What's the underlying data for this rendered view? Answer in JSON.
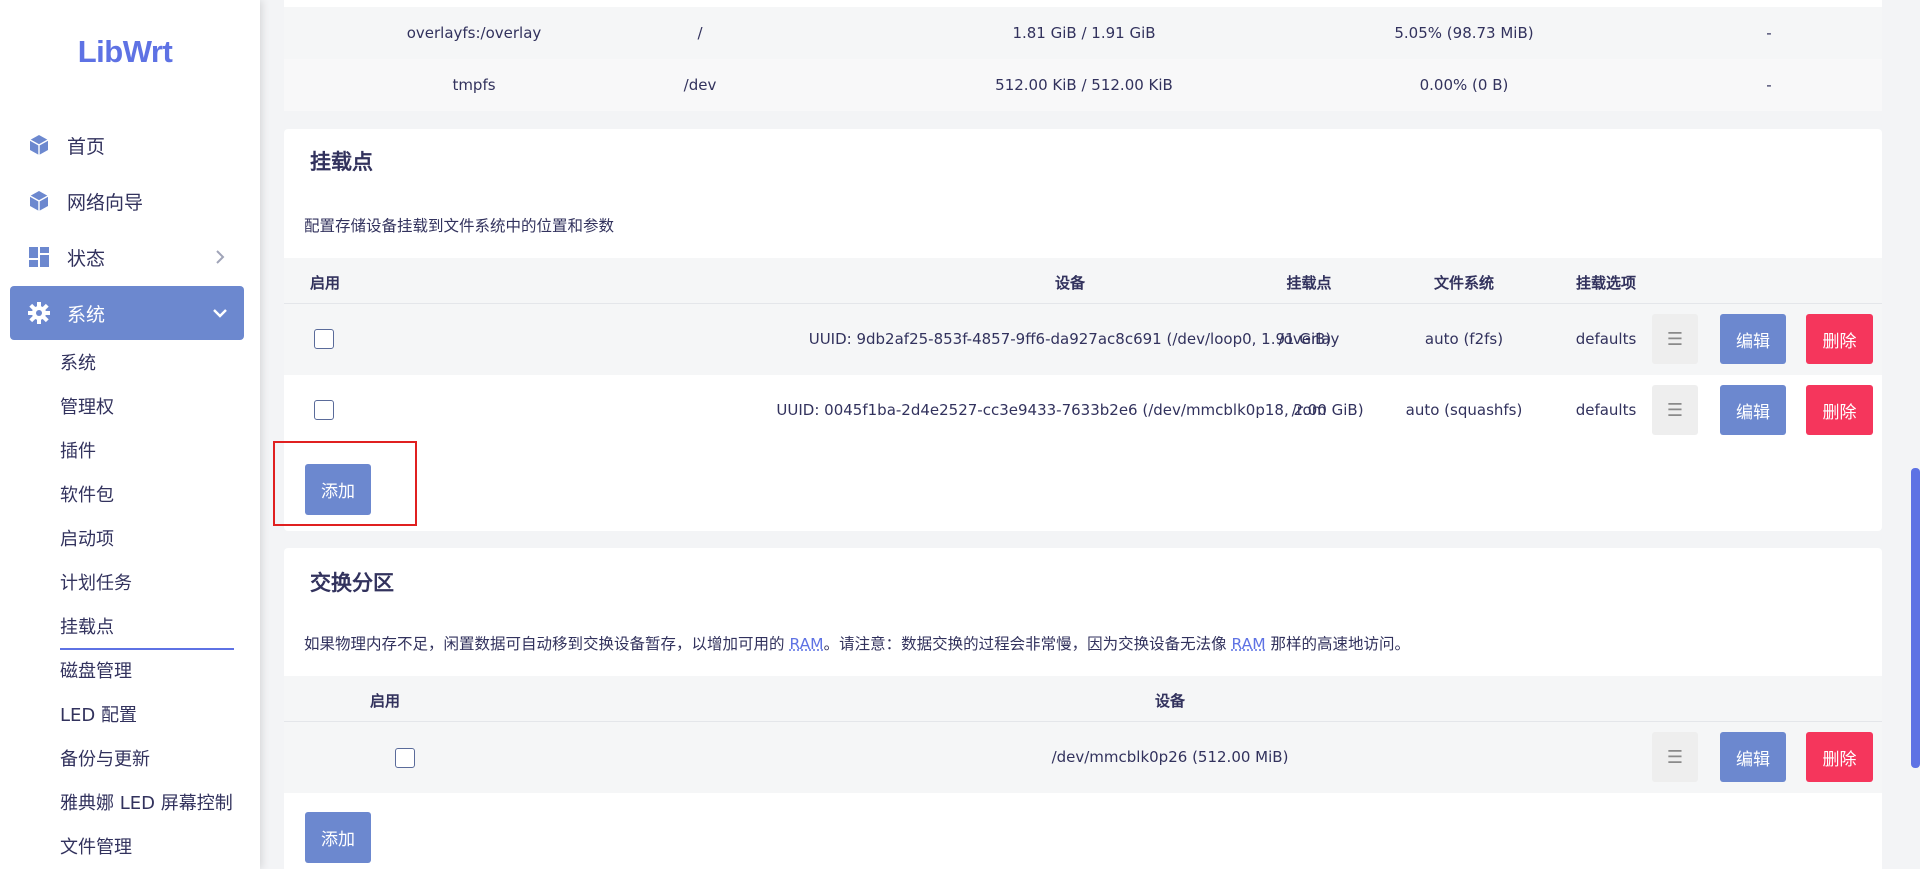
{
  "brand": {
    "logo_text": "LibWrt"
  },
  "sidebar": {
    "top_items": [
      {
        "label": "首页",
        "icon": "cube-icon"
      },
      {
        "label": "网络向导",
        "icon": "cube-icon"
      },
      {
        "label": "状态",
        "icon": "dashboard-icon"
      },
      {
        "label": "系统",
        "icon": "gear-icon"
      }
    ],
    "sub_items": [
      {
        "label": "系统"
      },
      {
        "label": "管理权"
      },
      {
        "label": "插件"
      },
      {
        "label": "软件包"
      },
      {
        "label": "启动项"
      },
      {
        "label": "计划任务"
      },
      {
        "label": "挂载点"
      },
      {
        "label": "磁盘管理"
      },
      {
        "label": "LED 配置"
      },
      {
        "label": "备份与更新"
      },
      {
        "label": "雅典娜 LED 屏幕控制"
      },
      {
        "label": "文件管理"
      }
    ],
    "active_item": "系统",
    "active_sub_item": "挂载点"
  },
  "filesystem_table": {
    "rows": [
      {
        "filesystem": "overlayfs:/overlay",
        "mount": "/",
        "size": "1.81 GiB / 1.91 GiB",
        "usage": "5.05% (98.73 MiB)",
        "action": "-"
      },
      {
        "filesystem": "tmpfs",
        "mount": "/dev",
        "size": "512.00 KiB / 512.00 KiB",
        "usage": "0.00% (0 B)",
        "action": "-"
      }
    ]
  },
  "mount_points": {
    "title": "挂载点",
    "description": "配置存储设备挂载到文件系统中的位置和参数",
    "headers": {
      "enabled": "启用",
      "device": "设备",
      "mount_point": "挂载点",
      "filesystem": "文件系统",
      "options": "挂载选项"
    },
    "rows": [
      {
        "device": "UUID: 9db2af25-853f-4857-9ff6-da927ac8c691 (/dev/loop0, 1.91 GiB)",
        "mount_point": "/overlay",
        "filesystem": "auto (f2fs)",
        "options": "defaults"
      },
      {
        "device": "UUID: 0045f1ba-2d4e2527-cc3e9433-7633b2e6 (/dev/mmcblk0p18, 2.00 GiB)",
        "mount_point": "/rom",
        "filesystem": "auto (squashfs)",
        "options": "defaults"
      }
    ],
    "menu_glyph": "☰",
    "edit_label": "编辑",
    "delete_label": "删除",
    "add_label": "添加"
  },
  "swap": {
    "title": "交换分区",
    "desc_part1": "如果物理内存不足，闲置数据可自动移到交换设备暂存，以增加可用的 ",
    "desc_ram1": "RAM",
    "desc_part2": "。请注意：数据交换的过程会非常慢，因为交换设备无法像 ",
    "desc_ram2": "RAM",
    "desc_part3": " 那样的高速地访问。",
    "headers": {
      "enabled": "启用",
      "device": "设备"
    },
    "rows": [
      {
        "device": "/dev/mmcblk0p26 (512.00 MiB)"
      }
    ],
    "menu_glyph": "☰",
    "edit_label": "编辑",
    "delete_label": "删除",
    "add_label": "添加"
  },
  "colors": {
    "accent": "#5e72e4",
    "button_primary": "#6c88cf",
    "button_danger": "#f5365c",
    "highlight_box": "#e02020"
  }
}
